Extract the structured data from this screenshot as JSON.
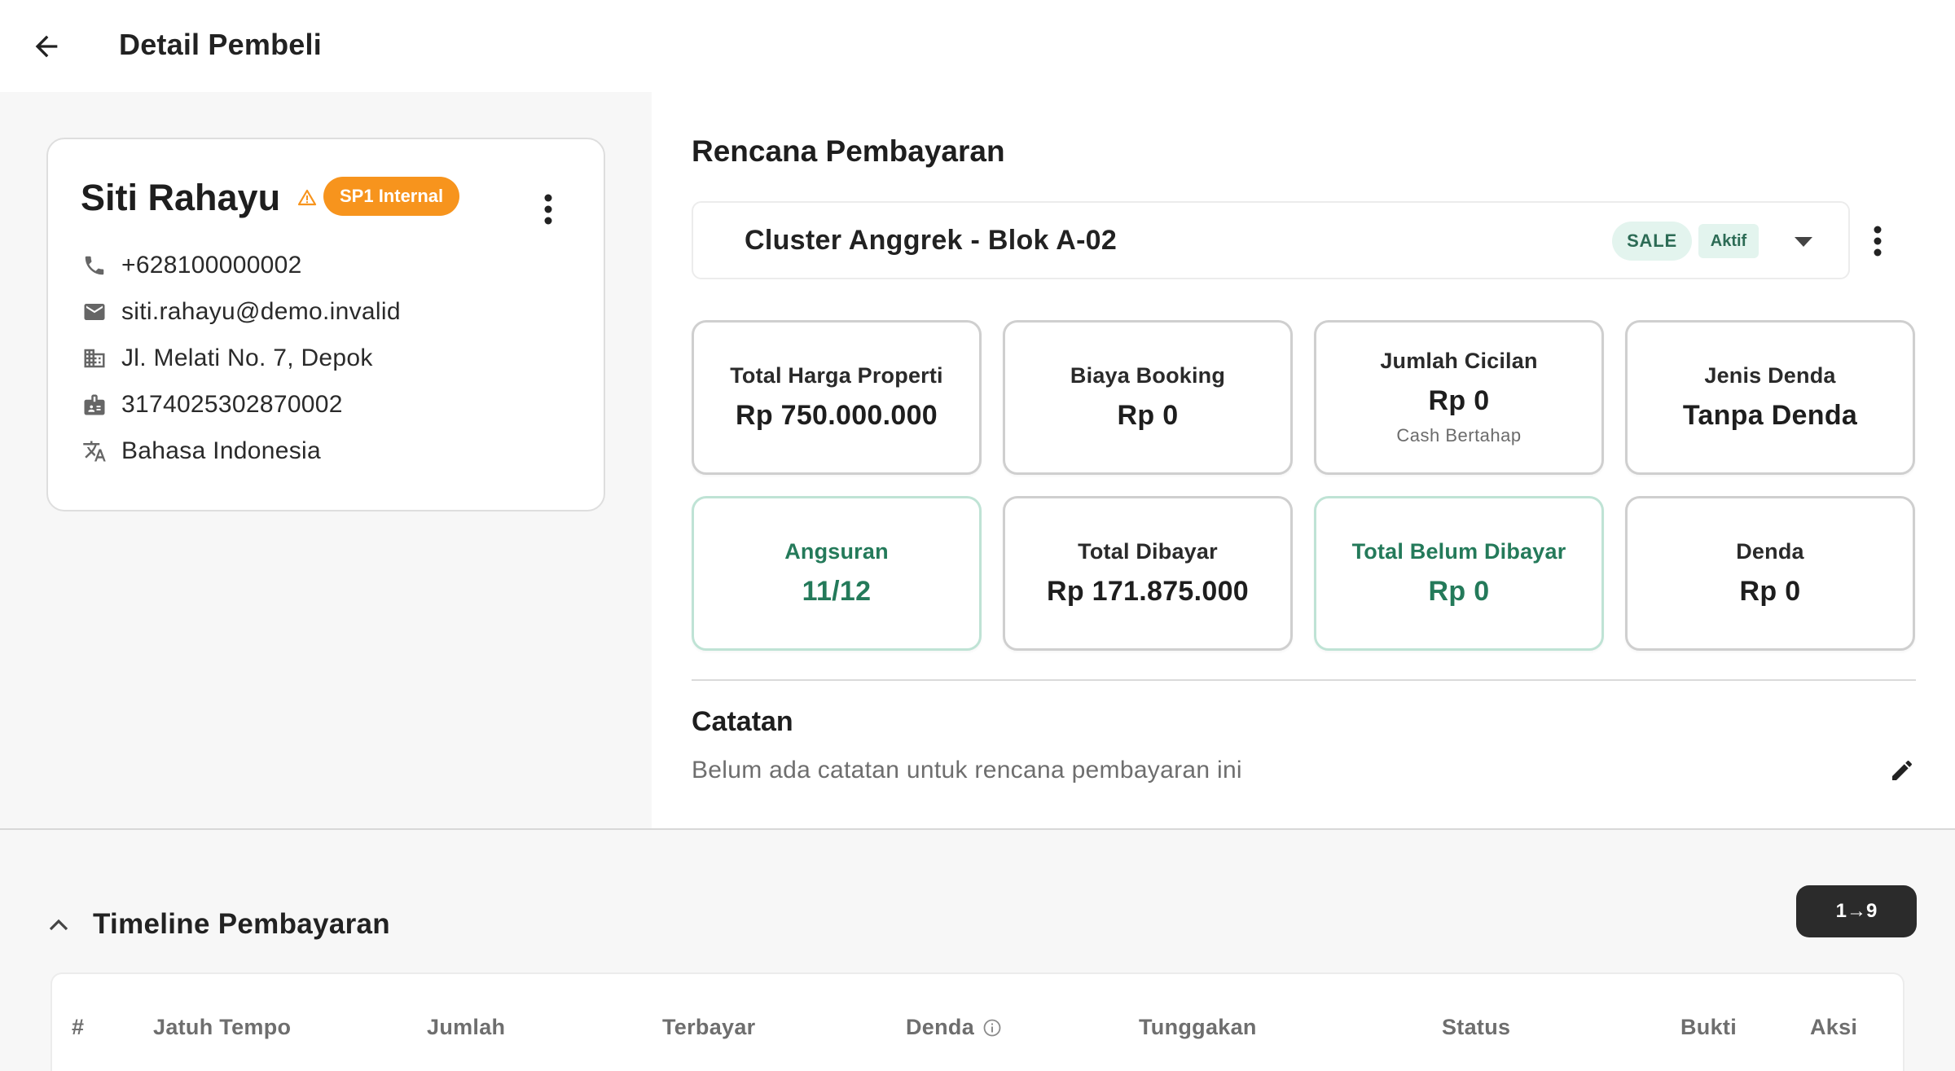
{
  "header": {
    "title": "Detail Pembeli"
  },
  "buyer": {
    "name": "Siti Rahayu",
    "badge": "SP1 Internal",
    "phone": "+628100000002",
    "email": "siti.rahayu@demo.invalid",
    "address": "Jl. Melati No. 7, Depok",
    "id_number": "3174025302870002",
    "language": "Bahasa Indonesia"
  },
  "plan": {
    "section_title": "Rencana Pembayaran",
    "selected_name": "Cluster Anggrek - Blok A-02",
    "chip_type": "SALE",
    "chip_status": "Aktif",
    "stats": [
      {
        "label": "Total Harga Properti",
        "value": "Rp 750.000.000"
      },
      {
        "label": "Biaya Booking",
        "value": "Rp 0"
      },
      {
        "label": "Jumlah Cicilan",
        "value": "Rp 0",
        "sub": "Cash Bertahap"
      },
      {
        "label": "Jenis Denda",
        "value": "Tanpa Denda"
      },
      {
        "label": "Angsuran",
        "value": "11/12"
      },
      {
        "label": "Total Dibayar",
        "value": "Rp 171.875.000"
      },
      {
        "label": "Total Belum Dibayar",
        "value": "Rp 0"
      },
      {
        "label": "Denda",
        "value": "Rp 0"
      }
    ]
  },
  "notes": {
    "title": "Catatan",
    "empty_text": "Belum ada catatan untuk rencana pembayaran ini"
  },
  "timeline": {
    "title": "Timeline Pembayaran",
    "sort_label": "1→9",
    "columns": [
      "#",
      "Jatuh Tempo",
      "Jumlah",
      "Terbayar",
      "Denda",
      "Tunggakan",
      "Status",
      "Bukti",
      "Aksi"
    ]
  },
  "colors": {
    "accent_green": "#247a5a",
    "badge_orange": "#f7941d",
    "chip_bg": "#e3f4ee"
  },
  "icons": [
    "arrow-back-icon",
    "warning-icon",
    "more-vert-icon",
    "phone-icon",
    "email-icon",
    "building-icon",
    "id-card-icon",
    "translate-icon",
    "arrow-drop-down-icon",
    "edit-icon",
    "chevron-up-icon",
    "info-icon"
  ]
}
